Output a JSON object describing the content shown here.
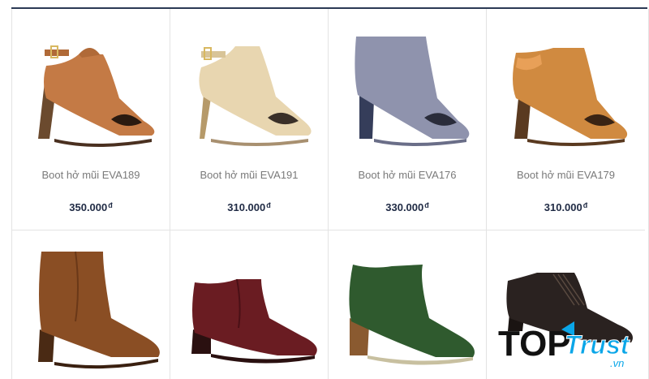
{
  "products": [
    {
      "name": "Boot hở mũi EVA189",
      "price": "350.000",
      "currency": "đ",
      "color": "#c47a45"
    },
    {
      "name": "Boot hở mũi EVA191",
      "price": "310.000",
      "currency": "đ",
      "color": "#e8d6b0"
    },
    {
      "name": "Boot hở mũi EVA176",
      "price": "330.000",
      "currency": "đ",
      "color": "#8f93ad"
    },
    {
      "name": "Boot hở mũi EVA179",
      "price": "310.000",
      "currency": "đ",
      "color": "#d08a40"
    },
    {
      "color": "#8a4e24"
    },
    {
      "color": "#6a1c22"
    },
    {
      "color": "#2f5a2e"
    },
    {
      "color": "#2a2220"
    }
  ],
  "logo": {
    "text_top": "TOP",
    "text_trust": "Trust",
    "text_domain": ".vn"
  }
}
